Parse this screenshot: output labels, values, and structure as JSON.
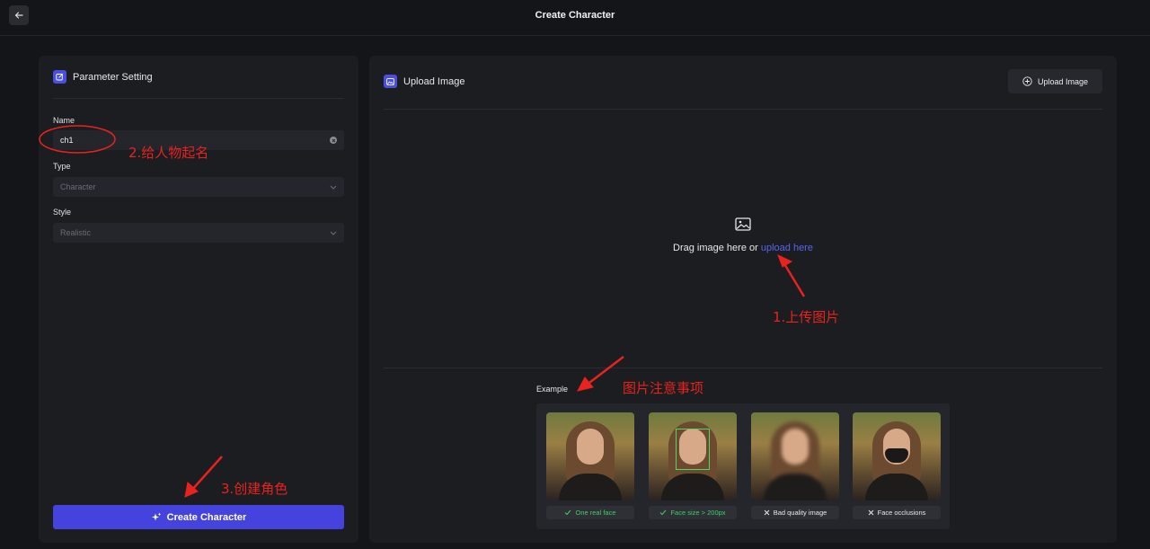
{
  "header": {
    "title": "Create Character"
  },
  "left_panel": {
    "title": "Parameter Setting",
    "name_label": "Name",
    "name_value": "ch1",
    "type_label": "Type",
    "type_placeholder": "Character",
    "style_label": "Style",
    "style_placeholder": "Realistic",
    "create_button": "Create Character"
  },
  "right_panel": {
    "title": "Upload Image",
    "upload_button": "Upload Image",
    "drop_text": "Drag image here or",
    "drop_link": "upload here",
    "example_label": "Example",
    "examples": [
      {
        "label": "One real face",
        "status": "good"
      },
      {
        "label": "Face size > 200px",
        "status": "good"
      },
      {
        "label": "Bad quality image",
        "status": "bad"
      },
      {
        "label": "Face occlusions",
        "status": "bad"
      }
    ]
  },
  "annotations": {
    "name_hint": "2.给人物起名",
    "upload_hint": "1.上传图片",
    "example_hint": "图片注意事项",
    "create_hint": "3.创建角色"
  },
  "colors": {
    "accent": "#4443dd",
    "link": "#5b63f0",
    "annotation": "#e8231e",
    "good": "#3ecf6a"
  }
}
